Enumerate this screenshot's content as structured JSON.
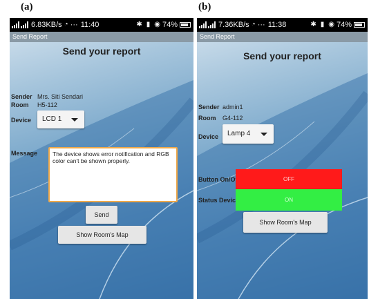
{
  "panels": {
    "a": {
      "label": "(a)",
      "status_bar": {
        "net_speed": "6.83KB/s",
        "dots": "···",
        "time": "11:40",
        "battery": "74%"
      },
      "window_title": "Send Report",
      "heading": "Send your report",
      "sender_label": "Sender",
      "sender_value": "Mrs. Siti Sendari",
      "room_label": "Room",
      "room_value": "H5-112",
      "device_label": "Device",
      "device_selected": "LCD 1",
      "message_label": "Message",
      "message_text": "The device shows error notification and RGB color can't be shown properly.",
      "send_label": "Send",
      "map_label": "Show Room's Map"
    },
    "b": {
      "label": "(b)",
      "status_bar": {
        "net_speed": "7.36KB/s",
        "dots": "···",
        "time": "11:38",
        "battery": "74%"
      },
      "window_title": "Send Report",
      "heading": "Send your report",
      "sender_label": "Sender",
      "sender_value": "admin1",
      "room_label": "Room",
      "room_value": "G4-112",
      "device_label": "Device",
      "device_selected": "Lamp 4",
      "button_label": "Button On/Off",
      "button_state": "OFF",
      "status_label": "Status Device",
      "status_state": "ON",
      "map_label": "Show Room's Map"
    }
  },
  "colors": {
    "status_bar": "#000000",
    "title_bar": "#8a9aa6",
    "message_border": "#f0a94a",
    "off_button": "#ff1a1a",
    "on_status": "#33ee44",
    "background_dark": "#2f6aa3"
  },
  "icons": [
    "signal-icon",
    "wifi-icon",
    "bluetooth-icon",
    "vibrate-icon",
    "alarm-icon",
    "battery-icon",
    "dropdown-caret-icon"
  ]
}
